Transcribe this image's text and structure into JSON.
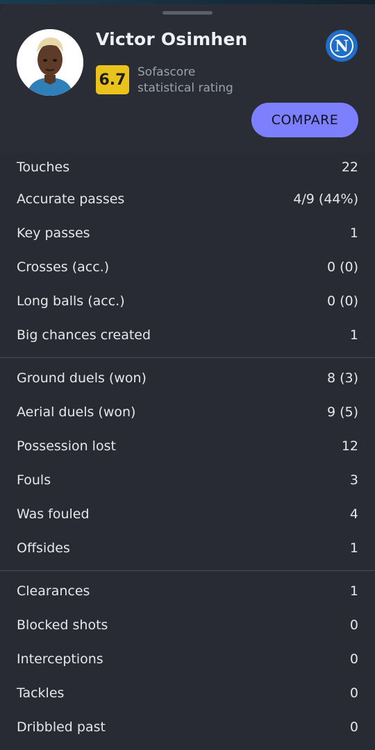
{
  "player": {
    "name": "Victor Osimhen",
    "rating": "6.7",
    "rating_caption": "Sofascore statistical rating",
    "club_logo_letter": "N"
  },
  "actions": {
    "compare_label": "COMPARE"
  },
  "colors": {
    "accent": "#7c80ff",
    "rating_bg": "#e9c21b",
    "background": "#282b34",
    "club_blue": "#1f6fc9"
  },
  "stats": {
    "groups": [
      {
        "rows": [
          {
            "label": "Touches",
            "value": "22"
          },
          {
            "label": "Accurate passes",
            "value": "4/9 (44%)"
          },
          {
            "label": "Key passes",
            "value": "1"
          },
          {
            "label": "Crosses (acc.)",
            "value": "0 (0)"
          },
          {
            "label": "Long balls (acc.)",
            "value": "0 (0)"
          },
          {
            "label": "Big chances created",
            "value": "1"
          }
        ]
      },
      {
        "rows": [
          {
            "label": "Ground duels (won)",
            "value": "8 (3)"
          },
          {
            "label": "Aerial duels (won)",
            "value": "9 (5)"
          },
          {
            "label": "Possession lost",
            "value": "12"
          },
          {
            "label": "Fouls",
            "value": "3"
          },
          {
            "label": "Was fouled",
            "value": "4"
          },
          {
            "label": "Offsides",
            "value": "1"
          }
        ]
      },
      {
        "rows": [
          {
            "label": "Clearances",
            "value": "1"
          },
          {
            "label": "Blocked shots",
            "value": "0"
          },
          {
            "label": "Interceptions",
            "value": "0"
          },
          {
            "label": "Tackles",
            "value": "0"
          },
          {
            "label": "Dribbled past",
            "value": "0"
          }
        ]
      }
    ]
  }
}
